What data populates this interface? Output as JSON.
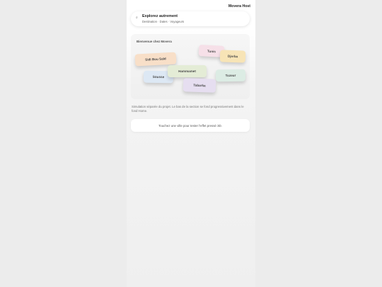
{
  "header": {
    "host_label": "Movera Host"
  },
  "search": {
    "title": "Explorez autrement",
    "subtitle": "Destination · Dates · Voyageurs",
    "icon": "search-icon"
  },
  "welcome": {
    "title": "Bienvenue chez Movera",
    "tiles": [
      {
        "label": "Tunis",
        "color": "#f6e0e8"
      },
      {
        "label": "Djerba",
        "color": "#f7e4b6"
      },
      {
        "label": "Sidi Bou Saïd",
        "color": "#f8dfc8"
      },
      {
        "label": "Hammamet",
        "color": "#e4ecd6"
      },
      {
        "label": "Sousse",
        "color": "#dde8f4"
      },
      {
        "label": "Tozeur",
        "color": "#dcece4"
      },
      {
        "label": "Tabarka",
        "color": "#e6def0"
      }
    ]
  },
  "simulation_text": "Simulation séparée du projet. Le bas de la section se fond progressivement dans le fond Home.",
  "touch_hint": "Touchez une ville pour tester l'effet pressé 3D."
}
